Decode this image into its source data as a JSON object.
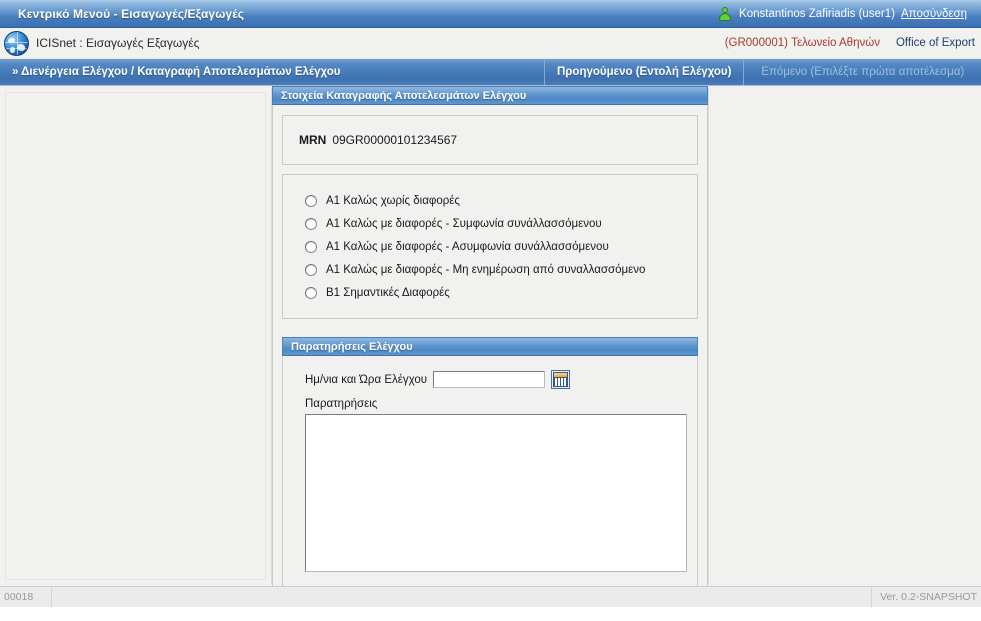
{
  "titlebar": {
    "title": "Κεντρικό Μενού - Εισαγωγές/Εξαγωγές",
    "user_icon": "user-icon",
    "username": "Konstantinos Zafiriadis (user1)",
    "logout_label": "Αποσύνδεση"
  },
  "brandbar": {
    "globe_icon": "globe-icon",
    "app_name": "ICISnet : Εισαγωγές Εξαγωγές",
    "office_code": "(GR000001) Τελωνείο Αθηνών",
    "office_role": "Office of Export"
  },
  "navbar": {
    "breadcrumb": "» Διενέργεια Ελέγχου / Καταγραφή Αποτελεσμάτων Ελέγχου",
    "prev_label": "Προηγούμενο (Εντολή Ελέγχου)",
    "next_label": "Επόμενο (Επιλέξτε πρώτα αποτέλεσμα)"
  },
  "main": {
    "section_title": "Στοιχεία Καταγραφής Αποτελεσμάτων Ελέγχου",
    "mrn_label": "MRN",
    "mrn_value": "09GR00000101234567",
    "results": [
      {
        "label": "Α1 Καλώς χωρίς διαφορές",
        "selected": false
      },
      {
        "label": "Α1 Καλώς με διαφορές - Συμφωνία συνάλλασσόμενου",
        "selected": false
      },
      {
        "label": "Α1 Καλώς με διαφορές - Ασυμφωνία συνάλλασσόμενου",
        "selected": false
      },
      {
        "label": "Α1 Καλώς με διαφορές - Μη ενημέρωση από συναλλασσόμενο",
        "selected": false
      },
      {
        "label": "Β1 Σημαντικές Διαφορές",
        "selected": false
      }
    ],
    "observations": {
      "section_title": "Παρατηρήσεις Ελέγχου",
      "date_label": "Ημ/νια και Ώρα Ελέγχου",
      "date_value": "",
      "date_placeholder": "",
      "calendar_icon": "calendar-icon",
      "notes_label": "Παρατηρήσεις",
      "notes_value": "",
      "notes_placeholder": ""
    }
  },
  "footer": {
    "screen_id": "00018",
    "version": "Ver. 0.2-SNAPSHOT"
  },
  "colors": {
    "accent_blue": "#4379b8",
    "title_blue": "#3f75b7",
    "panel_bg": "#f1f1f0",
    "office_code_red": "#a8392f",
    "office_role_blue": "#1f3e6e",
    "user_icon_green": "#5fcf3d"
  }
}
